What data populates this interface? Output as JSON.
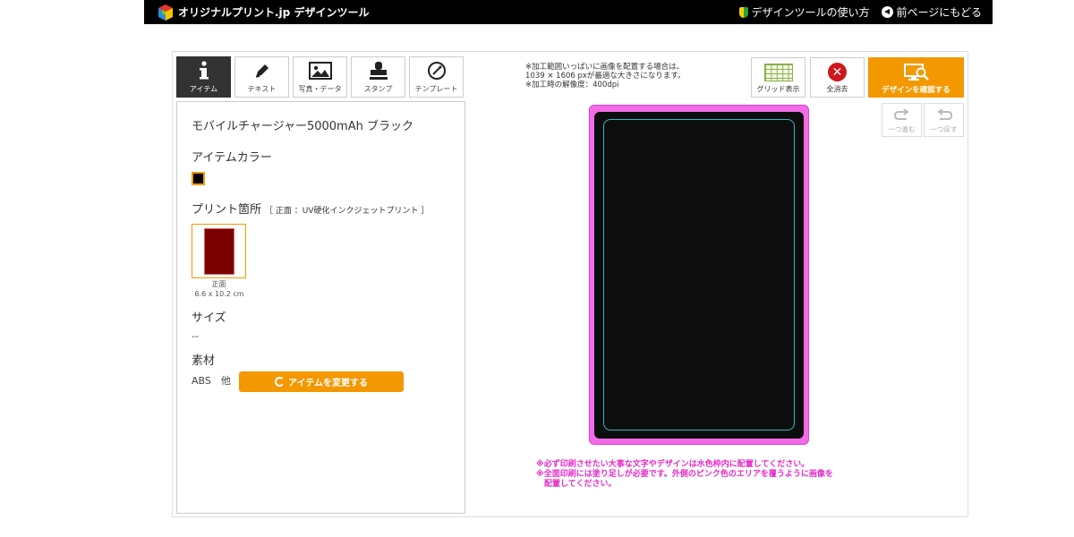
{
  "header": {
    "logo_text": "オリジナルプリント.jp デザインツール",
    "howto_label": "デザインツールの使い方",
    "back_label": "前ページにもどる"
  },
  "tabs": [
    {
      "label": "アイテム",
      "icon": "info-icon",
      "active": true
    },
    {
      "label": "テキスト",
      "icon": "pen-icon",
      "active": false
    },
    {
      "label": "写真・データ",
      "icon": "image-icon",
      "active": false
    },
    {
      "label": "スタンプ",
      "icon": "stamp-icon",
      "active": false
    },
    {
      "label": "テンプレート",
      "icon": "template-icon",
      "active": false
    }
  ],
  "item": {
    "name": "モバイルチャージャー5000mAh ブラック",
    "color_title": "アイテムカラー",
    "color_value": "#000000",
    "print_title": "プリント箇所",
    "print_note": "［ 正面 ：UV硬化インクジェットプリント ］",
    "location_name": "正面",
    "location_size": "6.6 x 10.2 cm",
    "size_title": "サイズ",
    "size_value": "--",
    "material_title": "素材",
    "material_value": "ABS　他",
    "change_button": "アイテムを変更する"
  },
  "top_note": "※加工範囲いっぱいに画像を配置する場合は、\n1039 × 1606 pxが最適な大きさになります。\n※加工時の解像度：400dpi",
  "toolbar": {
    "grid_label": "グリッド表示",
    "clear_label": "全消去",
    "confirm_label": "デザインを確認する",
    "redo_label": "一つ進む",
    "undo_label": "一つ戻す"
  },
  "bottom_note": "※必ず印刷させたい大事な文字やデザインは水色枠内に配置してください。\n※全面印刷には塗り足しが必要です。外側のピンク色のエリアを覆うように画像を\n　配置してください。",
  "colors": {
    "accent": "#f39800",
    "bleed": "#f46be8",
    "safe_area": "#2fb8c8",
    "clear": "#d0161d"
  }
}
